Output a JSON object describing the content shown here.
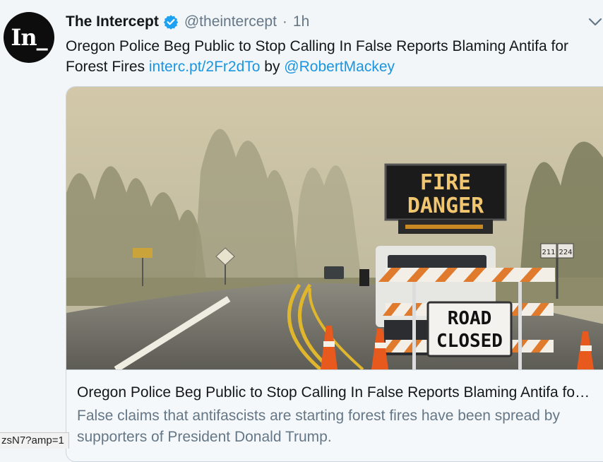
{
  "tweet": {
    "avatar_text": "In_",
    "display_name": "The Intercept",
    "handle": "@theintercept",
    "separator": "·",
    "time": "1h",
    "text_main": "Oregon Police Beg Public to Stop Calling In False Reports Blaming Antifa for Forest Fires ",
    "link_text": "interc.pt/2Fr2dTo",
    "by_text": " by ",
    "mention_text": "@RobertMackey"
  },
  "card": {
    "image_sign_line1": "FIRE",
    "image_sign_line2": "DANGER",
    "image_road_line1": "ROAD",
    "image_road_line2": "CLOSED",
    "image_route_left": "211",
    "image_route_right": "224",
    "title": "Oregon Police Beg Public to Stop Calling In False Reports Blaming Antifa for Forest Fires",
    "description": "False claims that antifascists are starting forest fires have been spread by supporters of President Donald Trump."
  },
  "status_bar": {
    "url_fragment": "zsN7?amp=1"
  },
  "colors": {
    "link": "#1b95e0",
    "verified": "#1da1f2",
    "muted": "#657786"
  },
  "icons": [
    "verified-badge-icon",
    "chevron-down-icon"
  ]
}
